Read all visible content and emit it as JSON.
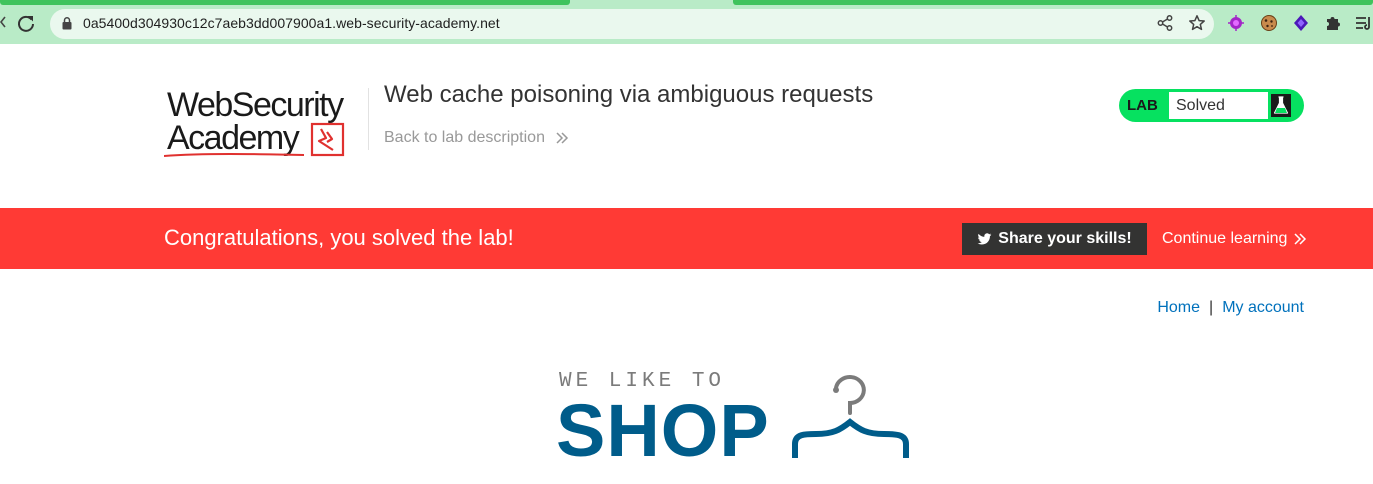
{
  "browser": {
    "url": "0a5400d304930c12c7aeb3dd007900a1.web-security-academy.net",
    "icons": [
      "reload-icon",
      "lock-icon",
      "share-icon",
      "star-icon",
      "extension-purple-icon",
      "cookie-icon",
      "hexagon-extension-icon",
      "puzzle-icon",
      "tab-search-icon"
    ]
  },
  "lab": {
    "logo_line1": "WebSecurity",
    "logo_line2": "Academy",
    "title": "Web cache poisoning via ambiguous requests",
    "back_link": "Back to lab description",
    "badge": "LAB",
    "status": "Solved"
  },
  "banner": {
    "message": "Congratulations, you solved the lab!",
    "share_label": "Share your skills!",
    "continue_label": "Continue learning"
  },
  "nav": {
    "home": "Home",
    "separator": "|",
    "account": "My account"
  },
  "shop_logo": {
    "tagline": "WE LIKE TO",
    "word": "SHOP"
  },
  "colors": {
    "browser_bar": "#b9ebc7",
    "lab_green": "#06e160",
    "banner_red": "#ff3a35",
    "link_blue": "#0071bc",
    "shop_blue": "#005c8a"
  }
}
